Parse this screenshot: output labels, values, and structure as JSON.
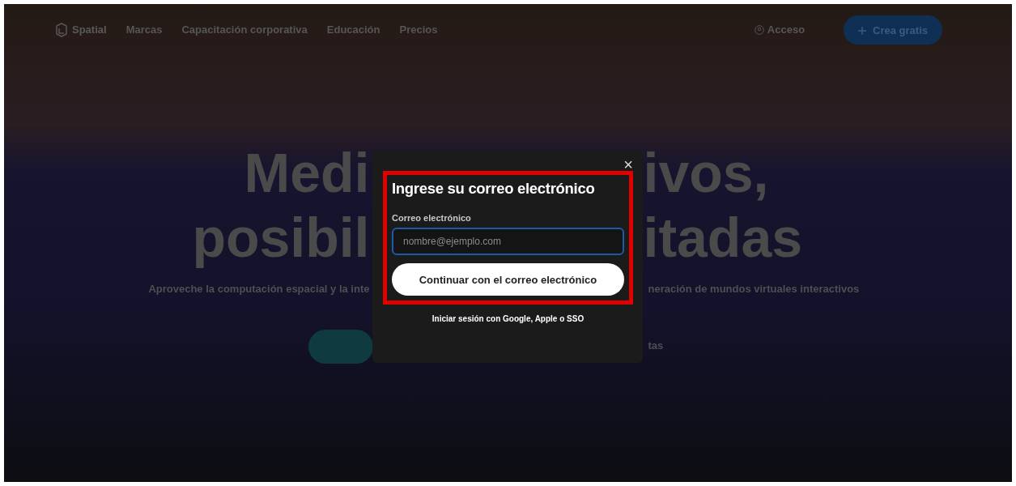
{
  "nav": {
    "brand": "Spatial",
    "links": [
      "Marcas",
      "Capacitación corporativa",
      "Educación",
      "Precios"
    ],
    "login": "Acceso",
    "cta": "Crea gratis"
  },
  "hero": {
    "headline_rows": [
      {
        "left": "Medi",
        "right": "ivos,"
      },
      {
        "left": "posibil",
        "right": "itadas"
      }
    ],
    "subtitle": {
      "left": "Aproveche la computación espacial y la inte",
      "right": "neración de mundos virtuales interactivos"
    },
    "secondary_link": "tas"
  },
  "modal": {
    "close": "×",
    "title": "Ingrese su correo electrónico",
    "email_label": "Correo electrónico",
    "email_placeholder": "nombre@ejemplo.com",
    "continue_button": "Continuar con el correo electrónico",
    "alt_signin": "Iniciar sesión con Google, Apple o SSO",
    "highlighted": true
  }
}
